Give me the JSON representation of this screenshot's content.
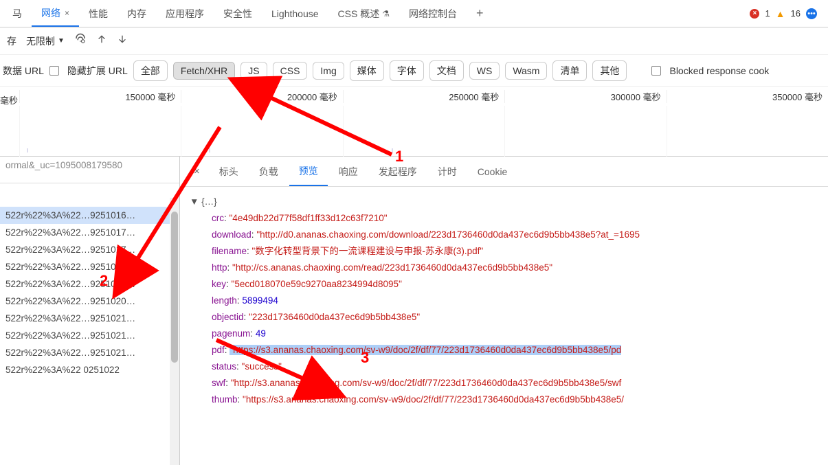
{
  "top_tabs": {
    "leading": "马",
    "tabs": [
      "网络",
      "性能",
      "内存",
      "应用程序",
      "安全性",
      "Lighthouse",
      "CSS 概述",
      "网络控制台"
    ],
    "active_index": 0,
    "css_overview_flask": "⚗",
    "add": "+",
    "errors_count": "1",
    "warnings_count": "16"
  },
  "toolbar": {
    "leading": "存",
    "throttle": "无限制",
    "caret": "▼"
  },
  "filters": {
    "data_url_label": "数据 URL",
    "hide_ext_label": "隐藏扩展 URL",
    "chips": [
      "全部",
      "Fetch/XHR",
      "JS",
      "CSS",
      "Img",
      "媒体",
      "字体",
      "文档",
      "WS",
      "Wasm",
      "清单",
      "其他"
    ],
    "selected_chip_index": 1,
    "blocked_label": "Blocked response cook"
  },
  "timeline": {
    "left_unit": "毫秒",
    "ticks": [
      "150000 毫秒",
      "200000 毫秒",
      "250000 毫秒",
      "300000 毫秒",
      "350000 毫秒"
    ]
  },
  "requests": {
    "first": "ormal&_uc=1095008179580",
    "items": [
      "522r%22%3A%22…9251016…",
      "522r%22%3A%22…9251017…",
      "522r%22%3A%22…9251017…",
      "522r%22%3A%22…9251018…",
      "522r%22%3A%22…9251020…",
      "522r%22%3A%22…9251020…",
      "522r%22%3A%22…9251021…",
      "522r%22%3A%22…9251021…",
      "522r%22%3A%22…9251021…",
      "522r%22%3A%22  0251022"
    ],
    "selected_index": 0
  },
  "detail_tabs": {
    "tabs": [
      "标头",
      "负载",
      "预览",
      "响应",
      "发起程序",
      "计时",
      "Cookie"
    ],
    "active_index": 2
  },
  "preview": {
    "root": "▼ {…}",
    "fields": [
      {
        "key": "crc",
        "type": "str",
        "value": "\"4e49db22d77f58df1ff33d12c63f7210\""
      },
      {
        "key": "download",
        "type": "str",
        "value": "\"http://d0.ananas.chaoxing.com/download/223d1736460d0da437ec6d9b5bb438e5?at_=1695"
      },
      {
        "key": "filename",
        "type": "str",
        "value": "\"数字化转型背景下的一流课程建设与申报-苏永康(3).pdf\""
      },
      {
        "key": "http",
        "type": "str",
        "value": "\"http://cs.ananas.chaoxing.com/read/223d1736460d0da437ec6d9b5bb438e5\""
      },
      {
        "key": "key",
        "type": "str",
        "value": "\"5ecd018070e59c9270aa8234994d8095\""
      },
      {
        "key": "length",
        "type": "num",
        "value": "5899494"
      },
      {
        "key": "objectid",
        "type": "str",
        "value": "\"223d1736460d0da437ec6d9b5bb438e5\""
      },
      {
        "key": "pagenum",
        "type": "num",
        "value": "49"
      },
      {
        "key": "pdf",
        "type": "str",
        "value": "\"https://s3.ananas.chaoxing.com/sv-w9/doc/2f/df/77/223d1736460d0da437ec6d9b5bb438e5/pd",
        "highlight": true
      },
      {
        "key": "status",
        "type": "str",
        "value": "\"success\""
      },
      {
        "key": "swf",
        "type": "str",
        "value": "\"http://s3.ananas.chaoxing.com/sv-w9/doc/2f/df/77/223d1736460d0da437ec6d9b5bb438e5/swf"
      },
      {
        "key": "thumb",
        "type": "str",
        "value": "\"https://s3.ananas.chaoxing.com/sv-w9/doc/2f/df/77/223d1736460d0da437ec6d9b5bb438e5/"
      }
    ]
  },
  "annotations": {
    "n1": "1",
    "n2": "2",
    "n3": "3"
  }
}
